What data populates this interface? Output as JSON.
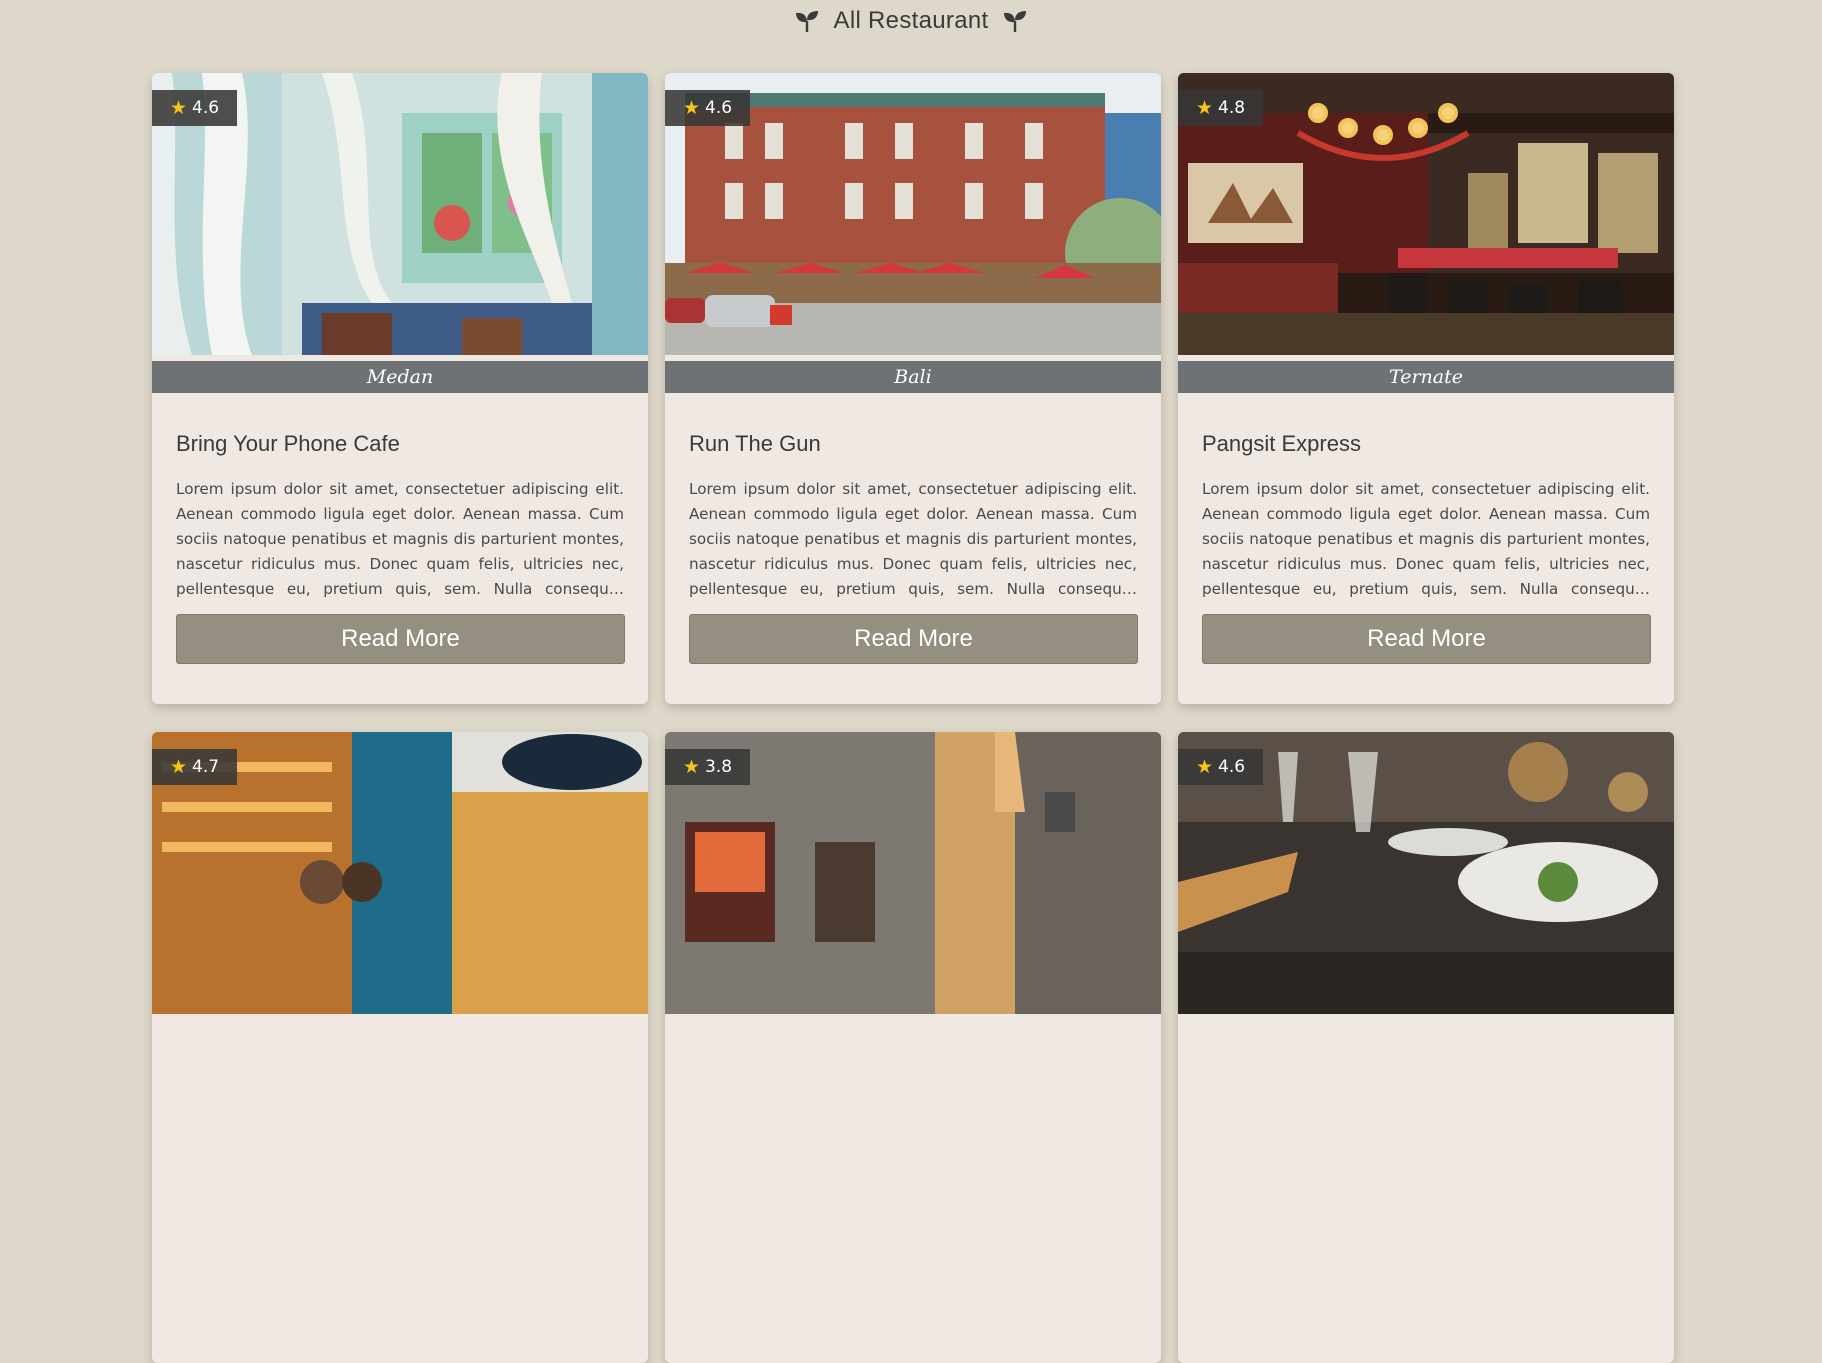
{
  "header": {
    "title": "All Restaurant",
    "left_icon": "sprout-icon",
    "right_icon": "sprout-icon"
  },
  "colors": {
    "page_bg": "#ded8ca",
    "card_bg": "#efe8e3",
    "location_bar": "#6f7275",
    "button_bg": "#948f80",
    "star": "#f5c518"
  },
  "restaurants": [
    {
      "rating": "4.6",
      "location": "Medan",
      "name": "Bring Your Phone Cafe",
      "description": "Lorem ipsum dolor sit amet, consectetuer adipiscing elit. Aenean commodo ligula eget dolor. Aenean massa. Cum sociis natoque penatibus et magnis dis parturient montes, nascetur ridiculus mus. Donec quam felis, ultricies nec, pellentesque eu, pretium quis, sem. Nulla consequat massa quis enim.",
      "button": "Read More",
      "image": "sunroom-cafe-photo"
    },
    {
      "rating": "4.6",
      "location": "Bali",
      "name": "Run The Gun",
      "description": "Lorem ipsum dolor sit amet, consectetuer adipiscing elit. Aenean commodo ligula eget dolor. Aenean massa. Cum sociis natoque penatibus et magnis dis parturient montes, nascetur ridiculus mus. Donec quam felis, ultricies nec, pellentesque eu, pretium quis, sem. Nulla consequat massa quis enim.",
      "button": "Read More",
      "image": "brick-building-terrace-photo"
    },
    {
      "rating": "4.8",
      "location": "Ternate",
      "name": "Pangsit Express",
      "description": "Lorem ipsum dolor sit amet, consectetuer adipiscing elit. Aenean commodo ligula eget dolor. Aenean massa. Cum sociis natoque penatibus et magnis dis parturient montes, nascetur ridiculus mus. Donec quam felis, ultricies nec, pellentesque eu, pretium quis, sem. Nulla consequat massa quis enim.",
      "button": "Read More",
      "image": "chandelier-bar-photo"
    },
    {
      "rating": "4.7",
      "image": "bakery-street-photo"
    },
    {
      "rating": "3.8",
      "image": "narrow-street-photo"
    },
    {
      "rating": "4.6",
      "image": "fine-dining-table-photo"
    }
  ]
}
